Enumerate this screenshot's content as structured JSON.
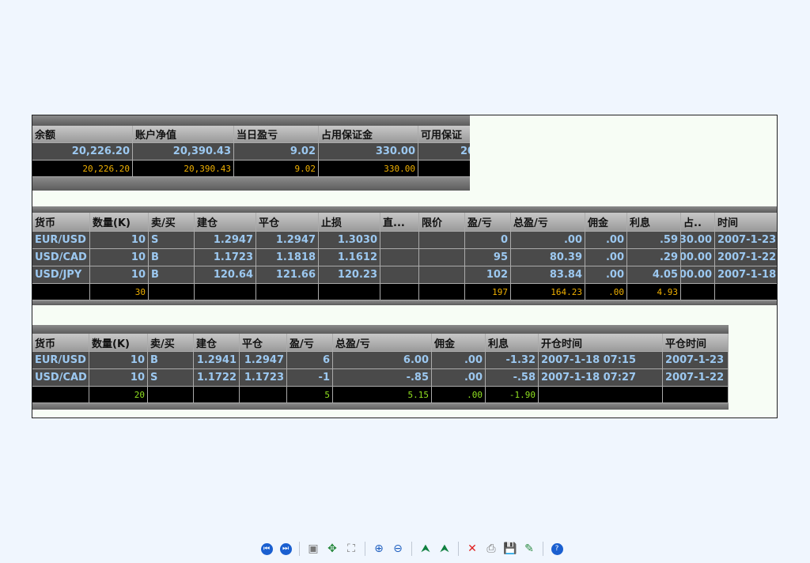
{
  "account": {
    "headers": [
      "余额",
      "账户净值",
      "当日盈亏",
      "占用保证金",
      "可用保证"
    ],
    "rows": [
      [
        "20,226.20",
        "20,390.43",
        "9.02",
        "330.00",
        "20,"
      ]
    ],
    "total": [
      "20,226.20",
      "20,390.43",
      "9.02",
      "330.00",
      "2"
    ],
    "total_color": "#f0b000"
  },
  "open_positions": {
    "headers": [
      "货币",
      "数量(K)",
      "卖/买",
      "建仓",
      "平仓",
      "止损",
      "直...",
      "限价",
      "盈/亏",
      "总盈/亏",
      "佣金",
      "利息",
      "占..",
      "时间"
    ],
    "rows": [
      [
        "EUR/USD",
        "10",
        "S",
        "1.2947",
        "1.2947",
        "1.3030",
        "",
        "",
        "0",
        ".00",
        ".00",
        ".59",
        "30.00",
        "2007-1-23"
      ],
      [
        "USD/CAD",
        "10",
        "B",
        "1.1723",
        "1.1818",
        "1.1612",
        "",
        "",
        "95",
        "80.39",
        ".00",
        ".29",
        "00.00",
        "2007-1-22"
      ],
      [
        "USD/JPY",
        "10",
        "B",
        "120.64",
        "121.66",
        "120.23",
        "",
        "",
        "102",
        "83.84",
        ".00",
        "4.05",
        "00.00",
        "2007-1-18"
      ]
    ],
    "total": [
      "",
      "30",
      "",
      "",
      "",
      "",
      "",
      "",
      "197",
      "164.23",
      ".00",
      "4.93",
      "",
      ""
    ],
    "total_color": "#f0b000"
  },
  "closed_positions": {
    "headers": [
      "货币",
      "数量(K)",
      "卖/买",
      "建仓",
      "平仓",
      "盈/亏",
      "总盈/亏",
      "佣金",
      "利息",
      "开仓时间",
      "平仓时间"
    ],
    "rows": [
      [
        "EUR/USD",
        "10",
        "B",
        "1.2941",
        "1.2947",
        "6",
        "6.00",
        ".00",
        "-1.32",
        "2007-1-18 07:15",
        "2007-1-23"
      ],
      [
        "USD/CAD",
        "10",
        "S",
        "1.1722",
        "1.1723",
        "-1",
        "-.85",
        ".00",
        "-.58",
        "2007-1-18 07:27",
        "2007-1-22"
      ]
    ],
    "total": [
      "",
      "20",
      "",
      "",
      "",
      "5",
      "5.15",
      ".00",
      "-1.90",
      "",
      ""
    ],
    "total_color": "#90e020"
  },
  "toolbar": [
    {
      "name": "first-page",
      "glyph": "⏮"
    },
    {
      "name": "next-page",
      "glyph": "⏭"
    },
    {
      "sep": true
    },
    {
      "name": "fit-page",
      "glyph": "▣"
    },
    {
      "name": "fit-width",
      "glyph": "✥"
    },
    {
      "name": "presentation",
      "glyph": "⛶"
    },
    {
      "sep": true
    },
    {
      "name": "zoom-in",
      "glyph": "⊕"
    },
    {
      "name": "zoom-out",
      "glyph": "⊖"
    },
    {
      "sep": true
    },
    {
      "name": "rotate-left",
      "glyph": "⮝"
    },
    {
      "name": "rotate-right",
      "glyph": "⮝"
    },
    {
      "sep": true
    },
    {
      "name": "close",
      "glyph": "✕"
    },
    {
      "name": "print",
      "glyph": "⎙"
    },
    {
      "name": "save",
      "glyph": "💾"
    },
    {
      "name": "edit",
      "glyph": "✎"
    },
    {
      "sep": true
    },
    {
      "name": "help",
      "glyph": "?"
    }
  ]
}
